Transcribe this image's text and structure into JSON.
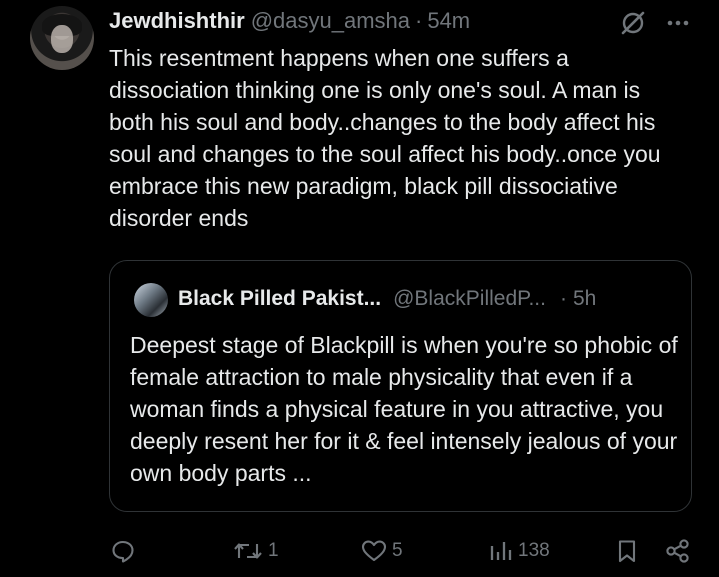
{
  "post": {
    "author": {
      "display_name": "Jewdhishthir",
      "handle": "@dasyu_amsha"
    },
    "separator": "·",
    "time": "54m",
    "text": "This resentment happens when one suffers a dissociation thinking one is only one's soul. A man is both his soul and body..changes to the body affect his soul and changes to the soul affect his body..once you embrace this new paradigm, black pill dissociative disorder ends",
    "quote": {
      "author": {
        "display_name": "Black Pilled Pakist...",
        "handle": "@BlackPilledP..."
      },
      "separator": "·",
      "time": "5h",
      "text": "Deepest stage of Blackpill is when you're so phobic of female attraction to male physicality that even if a woman finds a physical feature in you attractive, you deeply resent her for it & feel intensely jealous of your own body parts ..."
    },
    "actions": {
      "reply": {
        "icon": "reply-icon",
        "count": ""
      },
      "repost": {
        "icon": "repost-icon",
        "count": "1"
      },
      "like": {
        "icon": "heart-icon",
        "count": "5"
      },
      "views": {
        "icon": "views-icon",
        "count": "138"
      },
      "bookmark": {
        "icon": "bookmark-icon"
      },
      "share": {
        "icon": "share-icon"
      }
    }
  },
  "colors": {
    "background": "#000000",
    "text_primary": "#e7e9ea",
    "text_secondary": "#71767b",
    "border": "#2f3336"
  }
}
